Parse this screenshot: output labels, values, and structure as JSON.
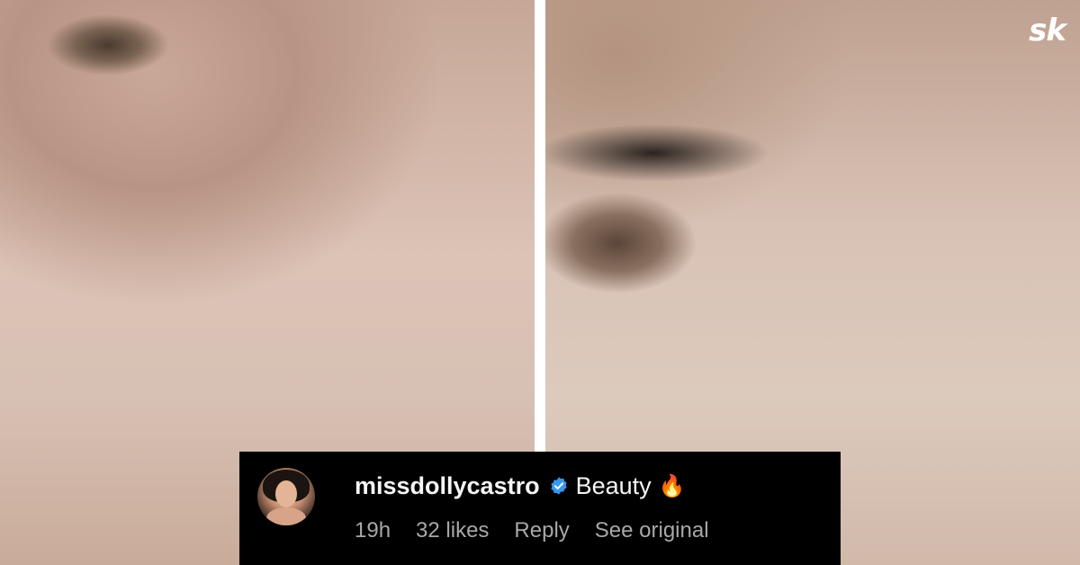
{
  "brand": {
    "logo_text": "sk"
  },
  "photos": [
    {
      "name": "left-photo",
      "description": ""
    },
    {
      "name": "right-photo",
      "description": ""
    }
  ],
  "comment": {
    "username": "missdollycastro",
    "verified": true,
    "text": "Beauty",
    "emoji": "🔥",
    "time": "19h",
    "likes": "32 likes",
    "reply_label": "Reply",
    "see_original_label": "See original"
  },
  "colors": {
    "verified_blue": "#3897f0",
    "card_bg": "#000000",
    "meta_grey": "#a8a8a8"
  }
}
